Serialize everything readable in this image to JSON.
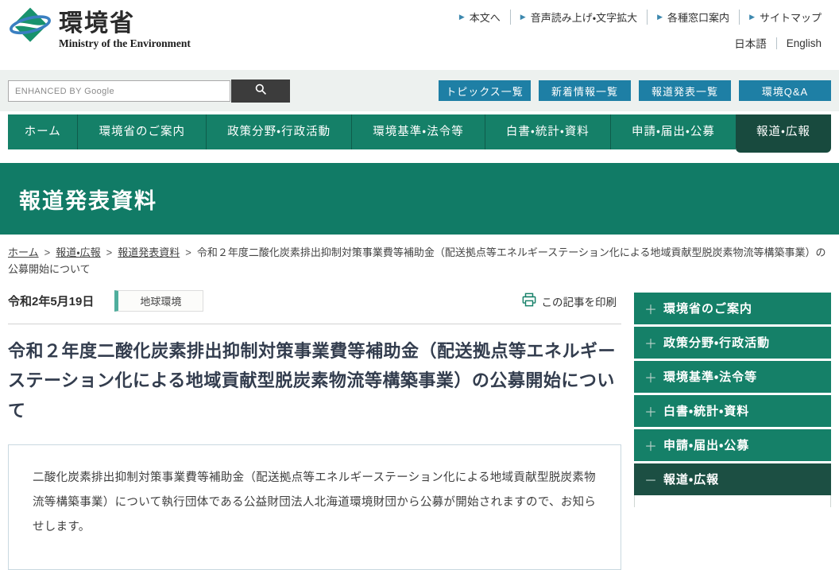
{
  "header": {
    "logo_title": "環境省",
    "logo_subtitle": "Ministry of the Environment",
    "top_links": [
      "本文へ",
      "音声読み上げ・文字拡大",
      "各種窓口案内",
      "サイトマップ"
    ],
    "lang_links": [
      "日本語",
      "English"
    ],
    "search_placeholder": "ENHANCED BY Google",
    "quick_buttons": [
      "トピックス一覧",
      "新着情報一覧",
      "報道発表一覧",
      "環境Q&A"
    ]
  },
  "nav": {
    "items": [
      "ホーム",
      "環境省のご案内",
      "政策分野・行政活動",
      "環境基準・法令等",
      "白書・統計・資料",
      "申請・届出・公募",
      "報道・広報"
    ],
    "active_item": "報道・広報"
  },
  "banner": {
    "title": "報道発表資料"
  },
  "breadcrumb": {
    "separator": ">",
    "links": [
      "ホーム",
      "報道・広報",
      "報道発表資料"
    ],
    "current": "令和２年度二酸化炭素排出抑制対策事業費等補助金（配送拠点等エネルギーステーション化による地域貢献型脱炭素物流等構築事業）の公募開始について"
  },
  "article": {
    "date": "令和2年5月19日",
    "category": "地球環境",
    "print_label": "この記事を印刷",
    "title": "令和２年度二酸化炭素排出抑制対策事業費等補助金（配送拠点等エネルギーステーション化による地域貢献型脱炭素物流等構築事業）の公募開始について",
    "body": "二酸化炭素排出抑制対策事業費等補助金（配送拠点等エネルギーステーション化による地域貢献型脱炭素物流等構築事業）について執行団体である公益財団法人北海道環境財団から公募が開始されますので、お知らせします。"
  },
  "sidebar": {
    "items": [
      {
        "label": "環境省のご案内",
        "icon": "＋",
        "expanded": false
      },
      {
        "label": "政策分野・行政活動",
        "icon": "＋",
        "expanded": false
      },
      {
        "label": "環境基準・法令等",
        "icon": "＋",
        "expanded": false
      },
      {
        "label": "白書・統計・資料",
        "icon": "＋",
        "expanded": false
      },
      {
        "label": "申請・届出・公募",
        "icon": "＋",
        "expanded": false
      },
      {
        "label": "報道・広報",
        "icon": "－",
        "expanded": true
      }
    ]
  },
  "colors": {
    "brand_green": "#158068",
    "active_dark_green": "#184a3e",
    "banner_green": "#117b66",
    "sidebar_active_green": "#1c4f43",
    "quick_button_blue": "#1e7fa5",
    "tag_accent_teal": "#4fae9d",
    "search_button_gray": "#3c3c3c"
  }
}
